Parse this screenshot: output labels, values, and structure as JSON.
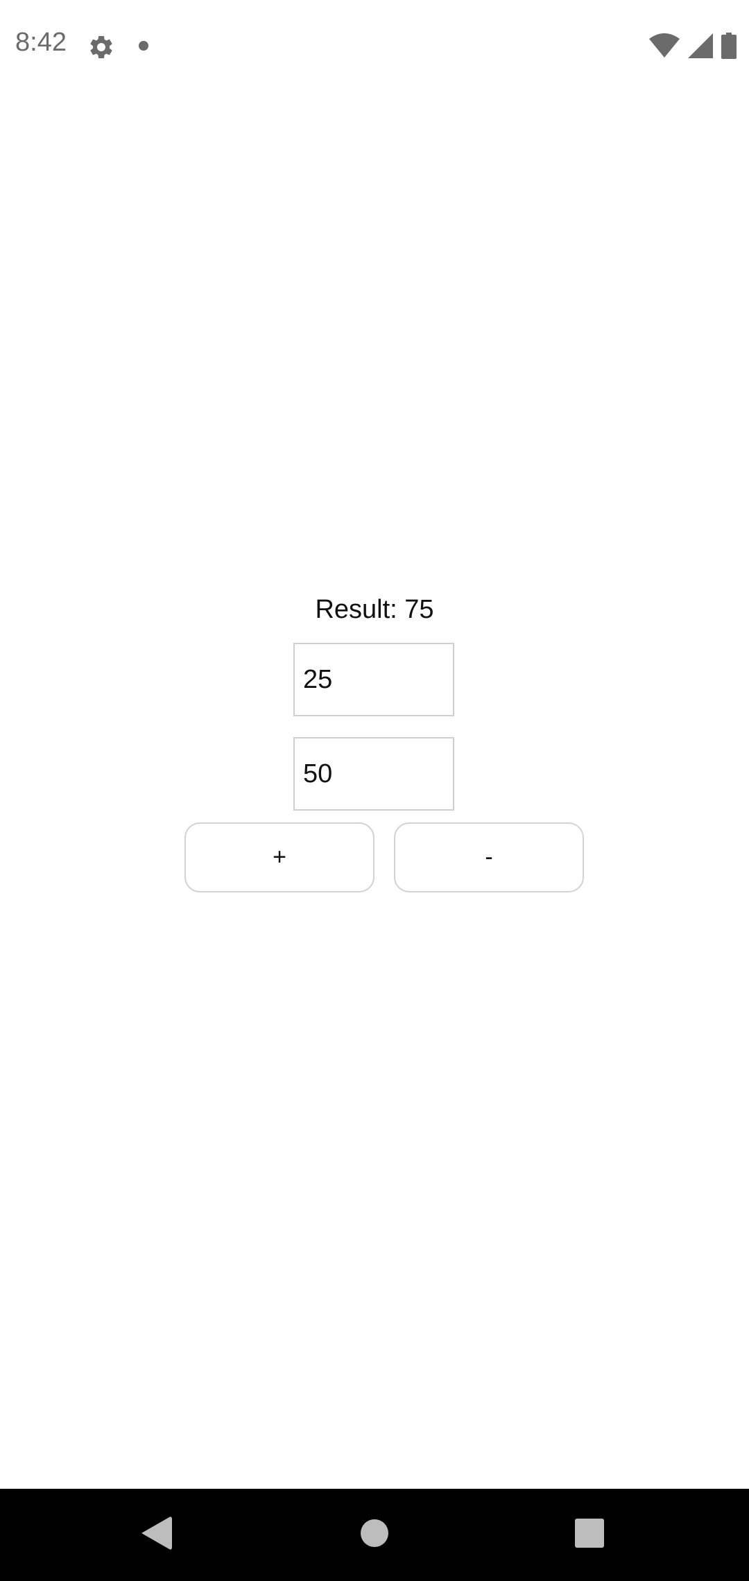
{
  "status_bar": {
    "time": "8:42",
    "icons": [
      "gear-icon",
      "notification-dot-icon",
      "wifi-icon",
      "signal-icon",
      "battery-icon"
    ],
    "icon_color": "#6b6b6b"
  },
  "calculator": {
    "result_text": "Result: 75",
    "first_value": "25",
    "second_value": "50",
    "plus_label": "+",
    "minus_label": "-"
  },
  "nav_bar": {
    "buttons": [
      "back-icon",
      "home-icon",
      "recents-icon"
    ],
    "background": "#000000",
    "icon_color": "#bdbdbd"
  }
}
